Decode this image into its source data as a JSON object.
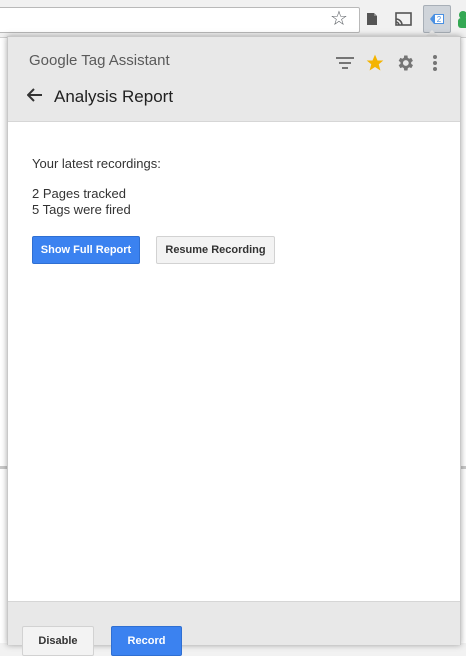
{
  "popup": {
    "brand_google": "Google",
    "brand_product": "Tag Assistant",
    "title": "Analysis Report",
    "recordings_label": "Your latest recordings:",
    "pages_tracked": "2 Pages tracked",
    "tags_fired": "5 Tags were fired",
    "show_full_report": "Show Full Report",
    "resume_recording": "Resume Recording",
    "disable": "Disable",
    "record": "Record"
  },
  "browser": {
    "extension_badge": "2"
  },
  "icons": {
    "filter": "filter-icon",
    "star": "star-icon",
    "gear": "gear-icon",
    "more": "more-vert-icon",
    "back": "back-arrow-icon"
  },
  "colors": {
    "accent": "#3b82f0",
    "star": "#f4b400",
    "header_bg": "#e8e8e8"
  }
}
